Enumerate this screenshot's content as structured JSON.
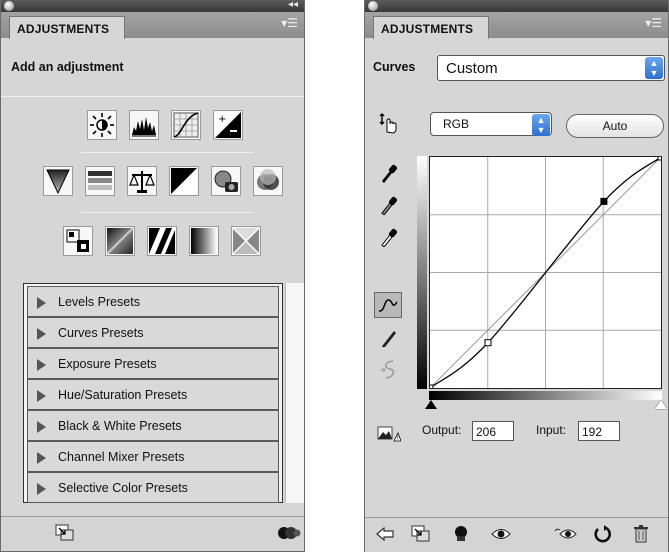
{
  "left_panel": {
    "tab_title": "ADJUSTMENTS",
    "subheading": "Add an adjustment",
    "icons_row1": [
      "brightness-contrast-icon",
      "levels-icon",
      "curves-icon",
      "exposure-icon"
    ],
    "icons_row2": [
      "vibrance-icon",
      "hue-saturation-icon",
      "color-balance-icon",
      "black-white-icon",
      "photo-filter-icon",
      "channel-mixer-icon"
    ],
    "icons_row3": [
      "invert-icon",
      "posterize-icon",
      "threshold-icon",
      "gradient-map-icon",
      "selective-color-icon"
    ],
    "presets": [
      "Levels Presets",
      "Curves Presets",
      "Exposure Presets",
      "Hue/Saturation Presets",
      "Black & White Presets",
      "Channel Mixer Presets",
      "Selective Color Presets"
    ],
    "bottom_icons": [
      "toggle-expanded-view-icon",
      "clip-to-layer-icon"
    ]
  },
  "right_panel": {
    "tab_title": "ADJUSTMENTS",
    "curves_label": "Curves",
    "preset_value": "Custom",
    "channel_value": "RGB",
    "auto_label": "Auto",
    "output_label": "Output:",
    "output_value": "206",
    "input_label": "Input:",
    "input_value": "192",
    "curve_points": [
      {
        "input": 0,
        "output": 0
      },
      {
        "input": 64,
        "output": 50
      },
      {
        "input": 192,
        "output": 206
      },
      {
        "input": 255,
        "output": 255
      }
    ],
    "bottom_icons": [
      "return-to-list-icon",
      "toggle-expanded-view-icon",
      "clip-to-layer-icon",
      "visibility-eye-icon",
      "view-previous-state-icon",
      "reset-icon",
      "trash-icon"
    ]
  },
  "colors": {
    "panel_bg": "#d6d6d6",
    "select_accent": "#2d6fd1"
  }
}
